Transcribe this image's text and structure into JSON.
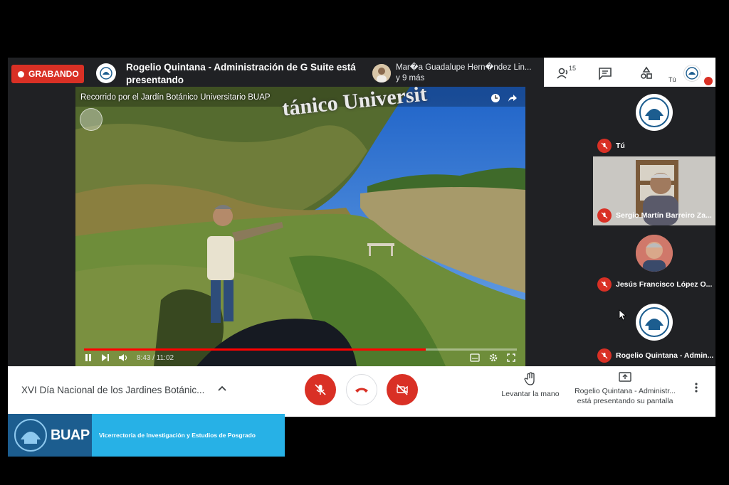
{
  "recording": {
    "label": "GRABANDO"
  },
  "presentation": {
    "presenter_text": "Rogelio Quintana - Administración de G Suite está presentando"
  },
  "participants": {
    "summary_line1": "Mar�a Guadalupe Hern�ndez Lin...",
    "summary_line2": "y 9 más",
    "count": "15"
  },
  "self": {
    "label": "Tú"
  },
  "video": {
    "title": "Recorrido por el Jardín Botánico Universitario BUAP",
    "overlay_text": "tánico Universit",
    "time": "8:43 / 11:02",
    "progress": 0.79
  },
  "tiles": [
    {
      "name": "Tú"
    },
    {
      "name": "Sergio Martín Barreiro Za..."
    },
    {
      "name": "Jesús Francisco López O..."
    },
    {
      "name": "Rogelio Quintana - Admin..."
    }
  ],
  "meeting": {
    "title": "XVI Día Nacional de los Jardines Botánic..."
  },
  "actions": {
    "raise_hand": "Levantar la mano",
    "presenting_line1": "Rogelio Quintana - Administr...",
    "presenting_line2": "está presentando su pantalla"
  },
  "banner": {
    "brand": "BUAP",
    "text": "Vicerrectoria de Investigación y Estudios de Posgrado"
  },
  "colors": {
    "danger": "#d93025",
    "banner_bg": "#27b1e6",
    "banner_logo_bg": "#1c5d8f",
    "dark_bg": "#202124"
  }
}
